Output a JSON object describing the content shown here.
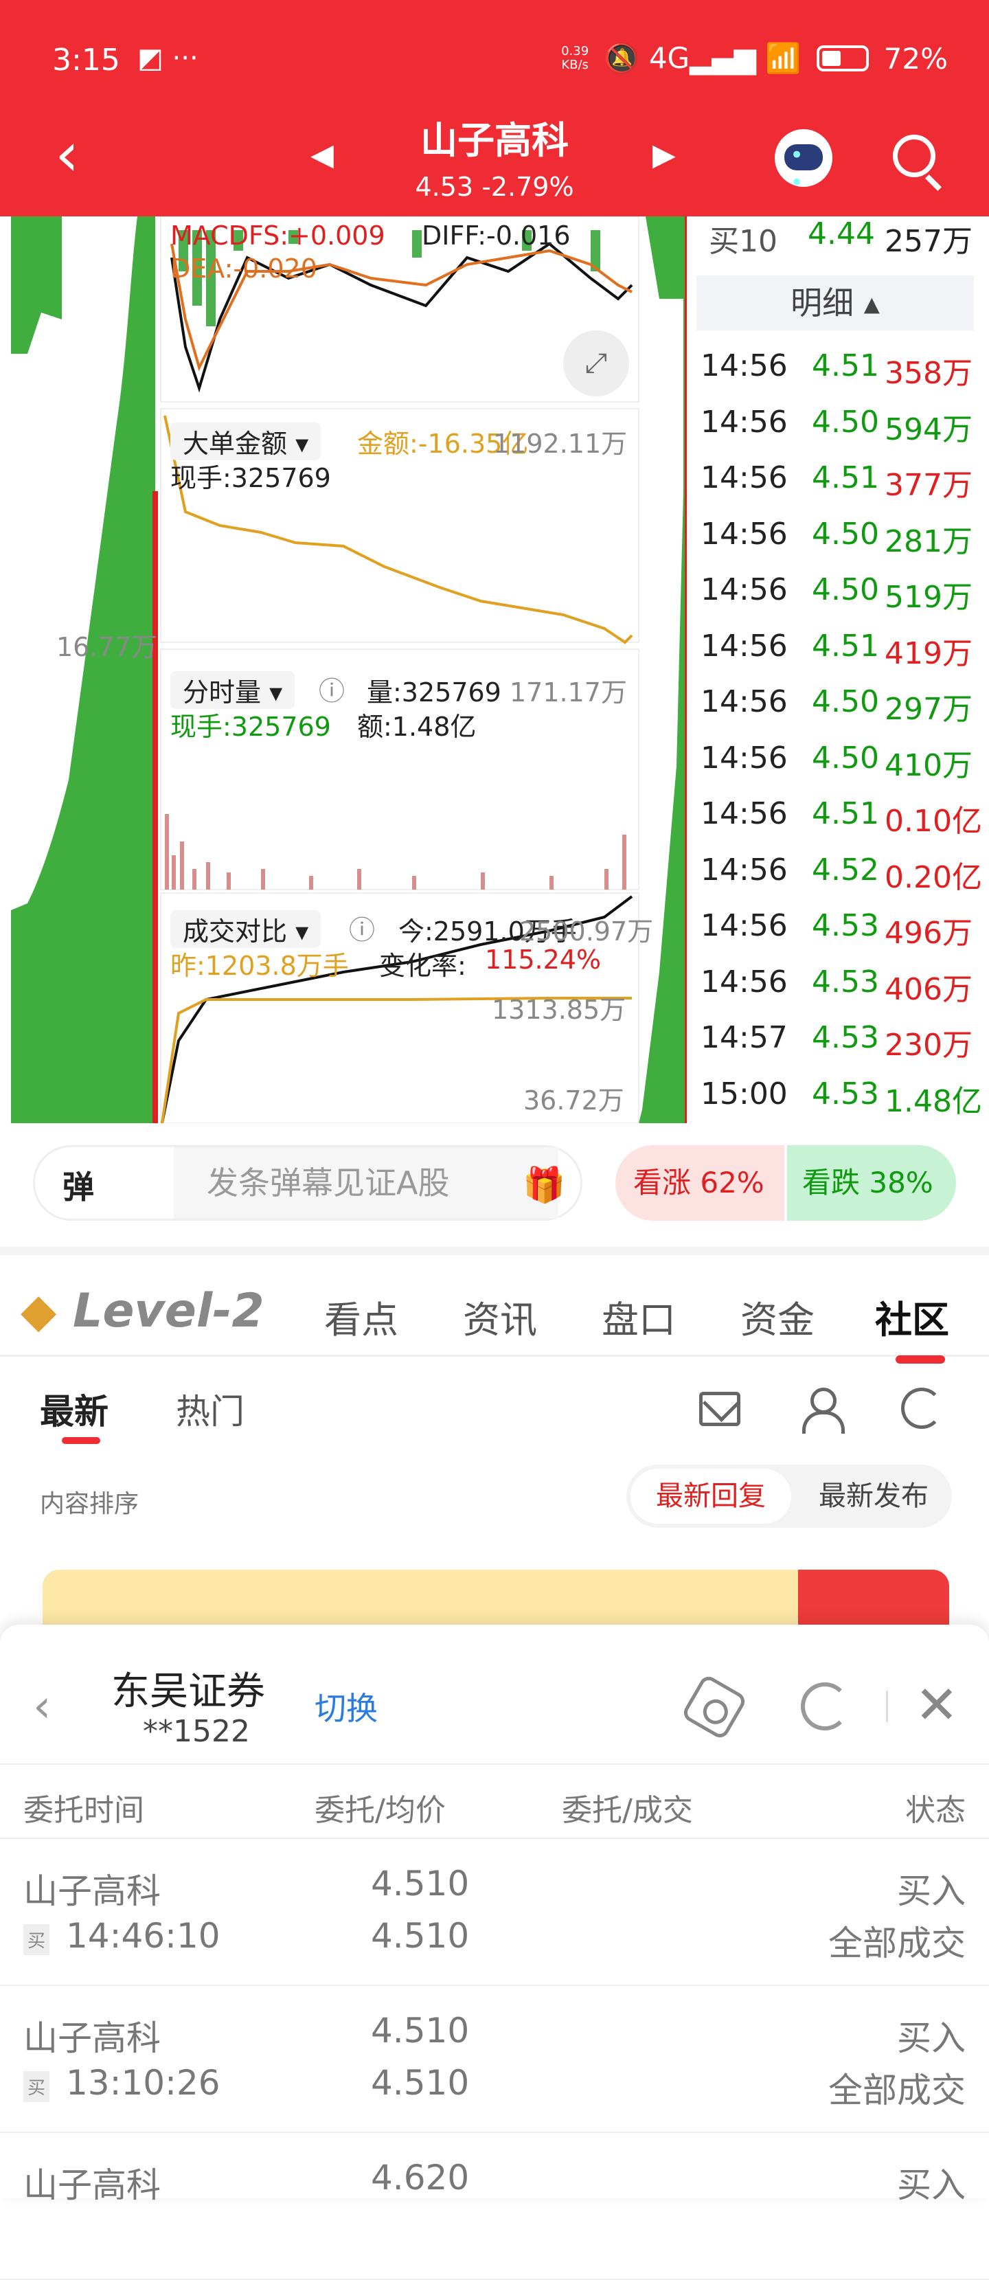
{
  "status_bar": {
    "time": "3:15",
    "left_icons": "◩ ···",
    "net_speed_value": "0.39",
    "net_speed_unit": "KB/s",
    "signal": "🔕 4G▂▄▆ 📶",
    "battery": "72%"
  },
  "header": {
    "stock_name": "山子高科",
    "quote": "4.53 -2.79%",
    "back_icon": "chevron-left-icon",
    "prev_icon": "◀",
    "next_icon": "▶"
  },
  "macd": {
    "dif_dea_label": "MACDFS:+0.009",
    "diff_label": "DIFF:-0.016",
    "dea_label": "DEA:-0.020"
  },
  "large_order": {
    "title": "大单金额 ▾",
    "amount_label": "金额:-16.35亿",
    "right_value": "1192.11万",
    "now_hand": "现手:325769"
  },
  "left_label": "16.77万",
  "volume": {
    "title": "分时量 ▾",
    "volume_label": "量:325769",
    "right_value": "171.17万",
    "now_hand": "现手:325769",
    "amount": "额:1.48亿"
  },
  "compare": {
    "title": "成交对比 ▾",
    "today": "今:2591.0万手",
    "right_value": "2500.97万",
    "yesterday": "昨:1203.8万手",
    "change_rate_label": "变化率:",
    "change_rate": "115.24%",
    "mid_value": "1313.85万",
    "low_value": "36.72万"
  },
  "detail": {
    "buy10_label": "买10",
    "buy10_price": "4.44",
    "buy10_volume": "257万",
    "tab_label": "明细 ▴",
    "trades": [
      {
        "time": "14:56",
        "price": "4.51",
        "volume": "358万",
        "dir": "up"
      },
      {
        "time": "14:56",
        "price": "4.50",
        "volume": "594万",
        "dir": "down"
      },
      {
        "time": "14:56",
        "price": "4.51",
        "volume": "377万",
        "dir": "up"
      },
      {
        "time": "14:56",
        "price": "4.50",
        "volume": "281万",
        "dir": "down"
      },
      {
        "time": "14:56",
        "price": "4.50",
        "volume": "519万",
        "dir": "down"
      },
      {
        "time": "14:56",
        "price": "4.51",
        "volume": "419万",
        "dir": "up"
      },
      {
        "time": "14:56",
        "price": "4.50",
        "volume": "297万",
        "dir": "down"
      },
      {
        "time": "14:56",
        "price": "4.50",
        "volume": "410万",
        "dir": "down"
      },
      {
        "time": "14:56",
        "price": "4.51",
        "volume": "0.10亿",
        "dir": "up"
      },
      {
        "time": "14:56",
        "price": "4.52",
        "volume": "0.20亿",
        "dir": "up"
      },
      {
        "time": "14:56",
        "price": "4.53",
        "volume": "496万",
        "dir": "up"
      },
      {
        "time": "14:56",
        "price": "4.53",
        "volume": "406万",
        "dir": "up"
      },
      {
        "time": "14:57",
        "price": "4.53",
        "volume": "230万",
        "dir": "up"
      },
      {
        "time": "15:00",
        "price": "4.53",
        "volume": "1.48亿",
        "dir": "down"
      }
    ]
  },
  "danmu": {
    "label": "弹",
    "placeholder": "发条弹幕见证A股",
    "gift_icon": "🎁",
    "bull": "看涨 62%",
    "bear": "看跌 38%"
  },
  "tabs": {
    "logo": "Level-2",
    "items": [
      "看点",
      "资讯",
      "盘口",
      "资金",
      "社区"
    ]
  },
  "subtabs": {
    "latest": "最新",
    "hot": "热门"
  },
  "sort": {
    "label": "内容排序",
    "reply": "最新回复",
    "publish": "最新发布"
  },
  "broker": {
    "name": "东吴证券",
    "account": "**1522",
    "switch": "切换",
    "back_icon": "‹",
    "close_icon": "✕"
  },
  "orders": {
    "headers": [
      "委托时间",
      "委托/均价",
      "委托/成交",
      "状态"
    ],
    "rows": [
      {
        "name": "山子高科",
        "tag": "买",
        "time": "14:46:10",
        "price": "4.510",
        "avg": "4.510",
        "side": "买入",
        "status": "全部成交"
      },
      {
        "name": "山子高科",
        "tag": "买",
        "time": "13:10:26",
        "price": "4.510",
        "avg": "4.510",
        "side": "买入",
        "status": "全部成交"
      },
      {
        "name": "山子高科",
        "tag": "",
        "time": "",
        "price": "4.620",
        "avg": "",
        "side": "买入",
        "status": ""
      }
    ]
  },
  "colors": {
    "header_red": "#ef2b33",
    "up_red": "#e02020",
    "down_green": "#109a10",
    "line_orange": "#e0a020"
  }
}
